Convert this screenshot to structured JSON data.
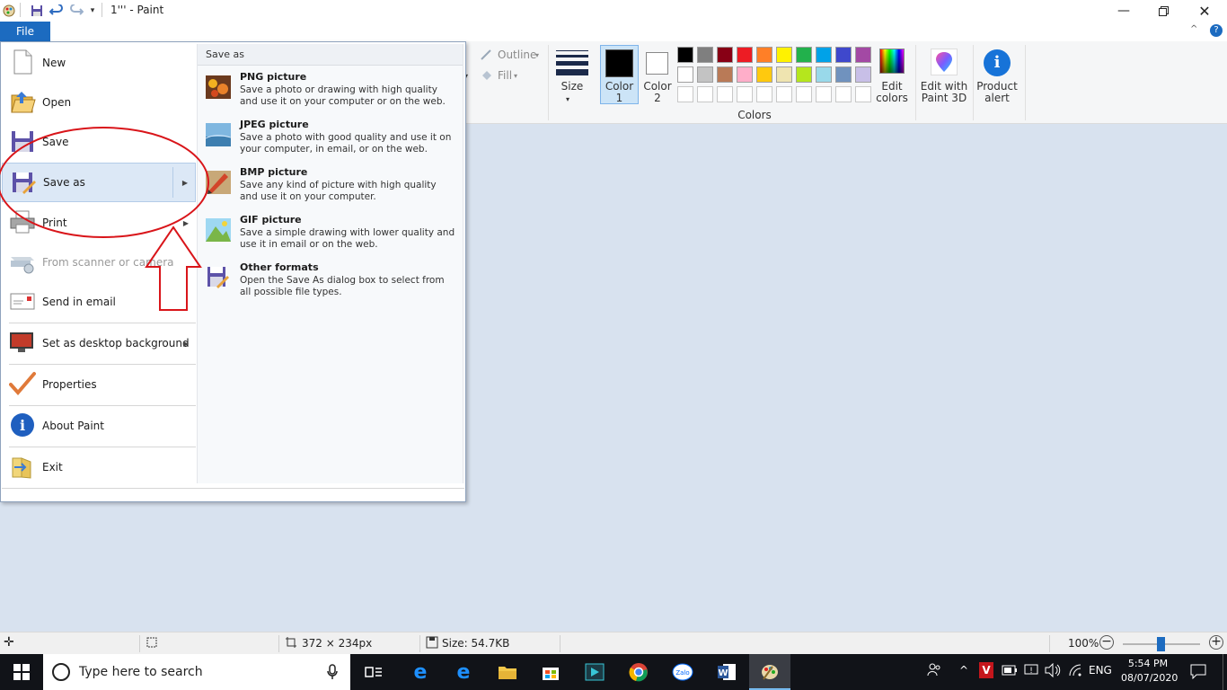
{
  "window": {
    "title": "1''' - Paint",
    "minimize_icon": "minimize-icon",
    "maximize_icon": "restore-icon",
    "close_icon": "close-icon"
  },
  "ribbon": {
    "file_tab": "File",
    "outline_label": "Outline",
    "fill_label": "Fill",
    "size_label": "Size",
    "color1_label": [
      "Color",
      "1"
    ],
    "color2_label": [
      "Color",
      "2"
    ],
    "colors_group_label": "Colors",
    "edit_colors_label": [
      "Edit",
      "colors"
    ],
    "edit_paint3d_label": [
      "Edit with",
      "Paint 3D"
    ],
    "product_alert_label": [
      "Product",
      "alert"
    ],
    "color1_value": "#000000",
    "color2_value": "#ffffff",
    "palette_row1": [
      "#000000",
      "#7f7f7f",
      "#880015",
      "#ed1c24",
      "#ff7f27",
      "#fff200",
      "#22b14c",
      "#00a2e8",
      "#3f48cc",
      "#a349a4"
    ],
    "palette_row2": [
      "#ffffff",
      "#c3c3c3",
      "#b97a57",
      "#ffaec9",
      "#ffc90e",
      "#efe4b0",
      "#b5e61d",
      "#99d9ea",
      "#7092be",
      "#c8bfe7"
    ]
  },
  "file_menu": {
    "items": [
      {
        "label": "New",
        "icon": "new-document-icon",
        "enabled": true
      },
      {
        "label": "Open",
        "icon": "open-folder-icon",
        "enabled": true
      },
      {
        "label": "Save",
        "icon": "save-disk-icon",
        "enabled": true
      },
      {
        "label": "Save as",
        "icon": "save-as-icon",
        "enabled": true,
        "submenu": true
      },
      {
        "label": "Print",
        "icon": "printer-icon",
        "enabled": true,
        "submenu": true
      },
      {
        "label": "From scanner or camera",
        "icon": "scanner-icon",
        "enabled": false
      },
      {
        "label": "Send in email",
        "icon": "email-icon",
        "enabled": true
      },
      {
        "label": "Set as desktop background",
        "icon": "desktop-icon",
        "enabled": true,
        "submenu": true
      },
      {
        "label": "Properties",
        "icon": "checkmark-icon",
        "enabled": true
      },
      {
        "label": "About Paint",
        "icon": "info-icon",
        "enabled": true
      },
      {
        "label": "Exit",
        "icon": "exit-icon",
        "enabled": true
      }
    ],
    "save_as": {
      "header": "Save as",
      "options": [
        {
          "title": "PNG picture",
          "desc": "Save a photo or drawing with high quality and use it on your computer or on the web.",
          "icon": "png-picture-icon"
        },
        {
          "title": "JPEG picture",
          "desc": "Save a photo with good quality and use it on your computer, in email, or on the web.",
          "icon": "jpeg-picture-icon"
        },
        {
          "title": "BMP picture",
          "desc": "Save any kind of picture with high quality and use it on your computer.",
          "icon": "bmp-picture-icon"
        },
        {
          "title": "GIF picture",
          "desc": "Save a simple drawing with lower quality and use it in email or on the web.",
          "icon": "gif-picture-icon"
        },
        {
          "title": "Other formats",
          "desc": "Open the Save As dialog box to select from all possible file types.",
          "icon": "other-formats-icon"
        }
      ]
    }
  },
  "statusbar": {
    "dimensions": "372 × 234px",
    "size": "Size: 54.7KB",
    "zoom": "100%",
    "zoom_level": 1.0
  },
  "taskbar": {
    "search_placeholder": "Type here to search",
    "language": "ENG",
    "time": "5:54 PM",
    "date": "08/07/2020"
  },
  "annotation_color": "#d9151a"
}
